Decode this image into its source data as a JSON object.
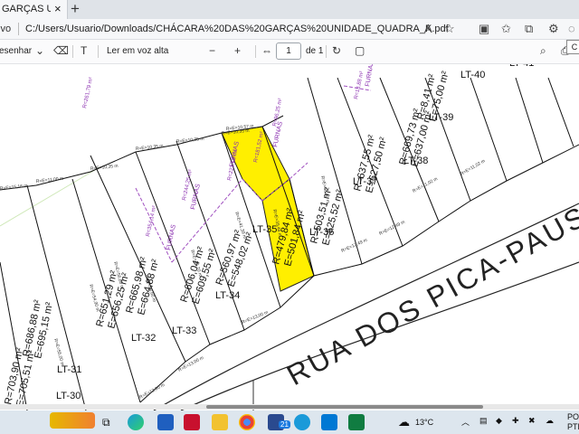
{
  "browser": {
    "tab_title": "GARÇAS UNIDAD",
    "tab_close": "×",
    "new_tab": "+",
    "addr_prefix": "ivo",
    "url": "C:/Users/Usuario/Downloads/CHÁCARA%20DAS%20GARÇAS%20UNIDADE_QUADRA_K.pdf"
  },
  "pdf_toolbar": {
    "draw_label": "esenhar",
    "read_aloud_label": "Ler em voz alta",
    "page_current": "1",
    "page_total": "de 1",
    "minus": "−",
    "plus": "+",
    "tooltip": "C"
  },
  "map": {
    "street_name": "RUA DOS PICA-PAUS",
    "highlight_color": "#ffef00",
    "lots": [
      {
        "lt": "LT-30",
        "r": "R=703,90 m²",
        "e": "E=705,51 m²"
      },
      {
        "lt": "LT-31",
        "r": "R=686,88 m²",
        "e": "E=695,15 m²"
      },
      {
        "lt": "LT-32",
        "r": "R=651,29 m²",
        "e": "E=656,25 m²"
      },
      {
        "lt": "LT-33",
        "r": "R=665,98 m²",
        "e": "E=664,88 m²"
      },
      {
        "lt": "LT-34",
        "r": "R=606,04 m²",
        "e": "E=609,55 m²"
      },
      {
        "lt": "LT-35",
        "r": "R=560,97 m²",
        "e": "E=548,02 m²"
      },
      {
        "lt": "LT-36",
        "r": "R=479,84 m²",
        "e": "E=501,84 m²"
      },
      {
        "lt": "LT-37",
        "r": "R=503,51 m²",
        "e": "E=525,52 m²"
      },
      {
        "lt": "LT-38",
        "r": "R=637,55 m²",
        "e": "E=627,50 m²"
      },
      {
        "lt": "LT-39",
        "r": "R=669,73 m²",
        "e": "E=637,00 m²"
      },
      {
        "lt": "LT-40",
        "r": "R=8,41 m²",
        "e": "E=75,00 m²"
      },
      {
        "lt": "LT-41",
        "r": "",
        "e": ""
      }
    ],
    "frontage_labels": [
      "R=E=12,00 m",
      "R=E=13,00 m",
      "R=E=13,00 m",
      "R=E=12,49 m",
      "R=E=12,49 m",
      "R=E=11,02 m",
      "R=E=11,02 m"
    ],
    "back_labels": [
      "R=E=15,16 m",
      "R=E=11,00 m",
      "R=E=10,35 m",
      "R=E=10,35 m",
      "R=E=10,35 m",
      "R=E=10,35 m",
      "R=E=10,57 m"
    ],
    "side_labels": [
      "R=E=55,00 m",
      "R=E=54,90 m",
      "R=E=56,80 m",
      "R=E=53,60 m",
      "R=E=46,70 m",
      "R=E=41,39 m",
      "R=E=39,46 m",
      "R=E=48,00 m"
    ],
    "purple_labels": [
      "FURNAS",
      "FURNAS",
      "FURNAS",
      "FURNAS",
      "FURNAS"
    ],
    "purple_areas": [
      "R=354,14 m²",
      "R=261,79 m²",
      "R=244,25 m²",
      "R=221,42 m²",
      "R=181,52 m²",
      "R=96,25 m²",
      "R=13,88 m²"
    ]
  },
  "taskbar": {
    "weather": "13°C",
    "lang": "POR",
    "lang2": "PTE",
    "badge": "21"
  }
}
